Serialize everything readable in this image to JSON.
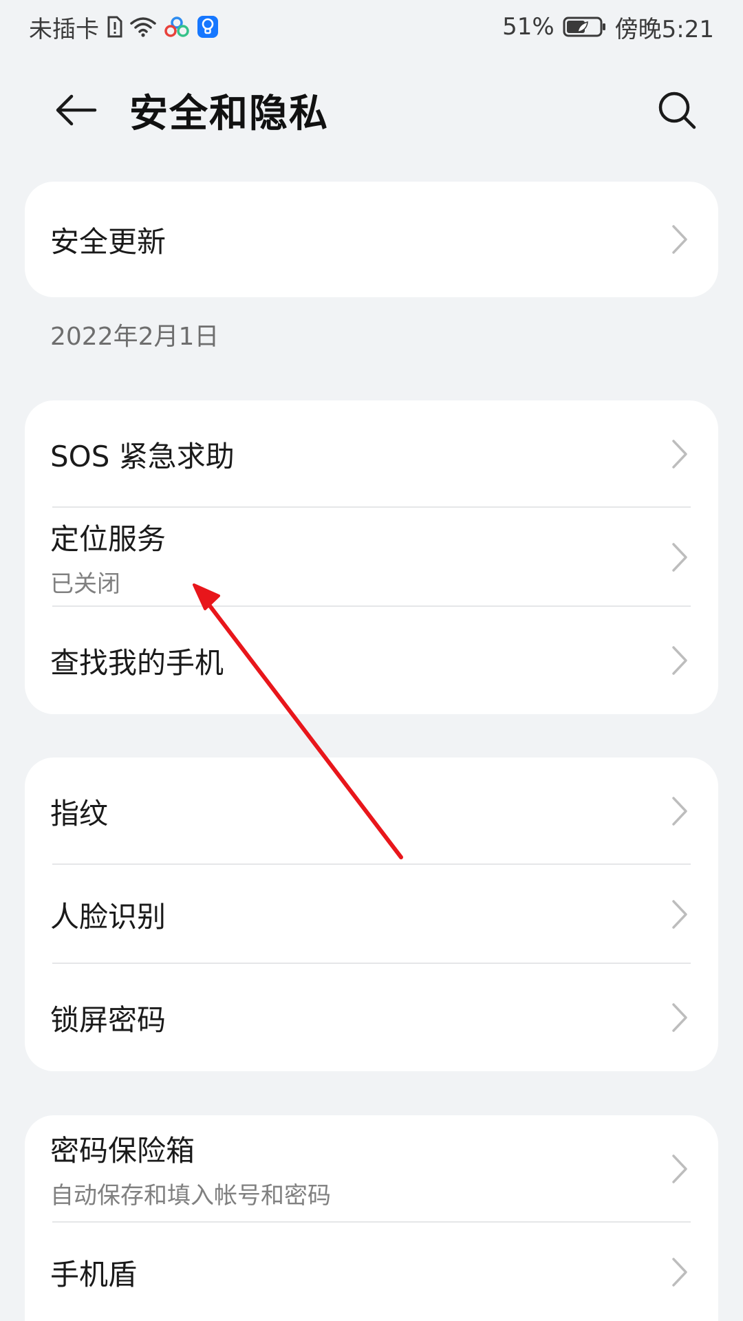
{
  "status_bar": {
    "carrier": "未插卡",
    "battery_percent": "51%",
    "time": "傍晚5:21",
    "icons": [
      "sim-alert-icon",
      "wifi-icon",
      "cloud-app-icon",
      "bulb-app-icon",
      "battery-icon"
    ]
  },
  "header": {
    "title": "安全和隐私",
    "back_icon": "arrow-left-icon",
    "search_icon": "search-icon"
  },
  "groups": {
    "update": {
      "label": "安全更新",
      "note": "2022年2月1日"
    },
    "safety": {
      "items": [
        {
          "label": "SOS 紧急求助"
        },
        {
          "label": "定位服务",
          "sub": "已关闭"
        },
        {
          "label": "查找我的手机"
        }
      ]
    },
    "biometrics": {
      "items": [
        {
          "label": "指纹"
        },
        {
          "label": "人脸识别"
        },
        {
          "label": "锁屏密码"
        }
      ]
    },
    "passwords": {
      "items": [
        {
          "label": "密码保险箱",
          "sub": "自动保存和填入帐号和密码"
        },
        {
          "label": "手机盾"
        }
      ]
    }
  },
  "colors": {
    "background": "#F1F3F5",
    "card": "#FFFFFF",
    "annotation_arrow": "#E8161B"
  }
}
